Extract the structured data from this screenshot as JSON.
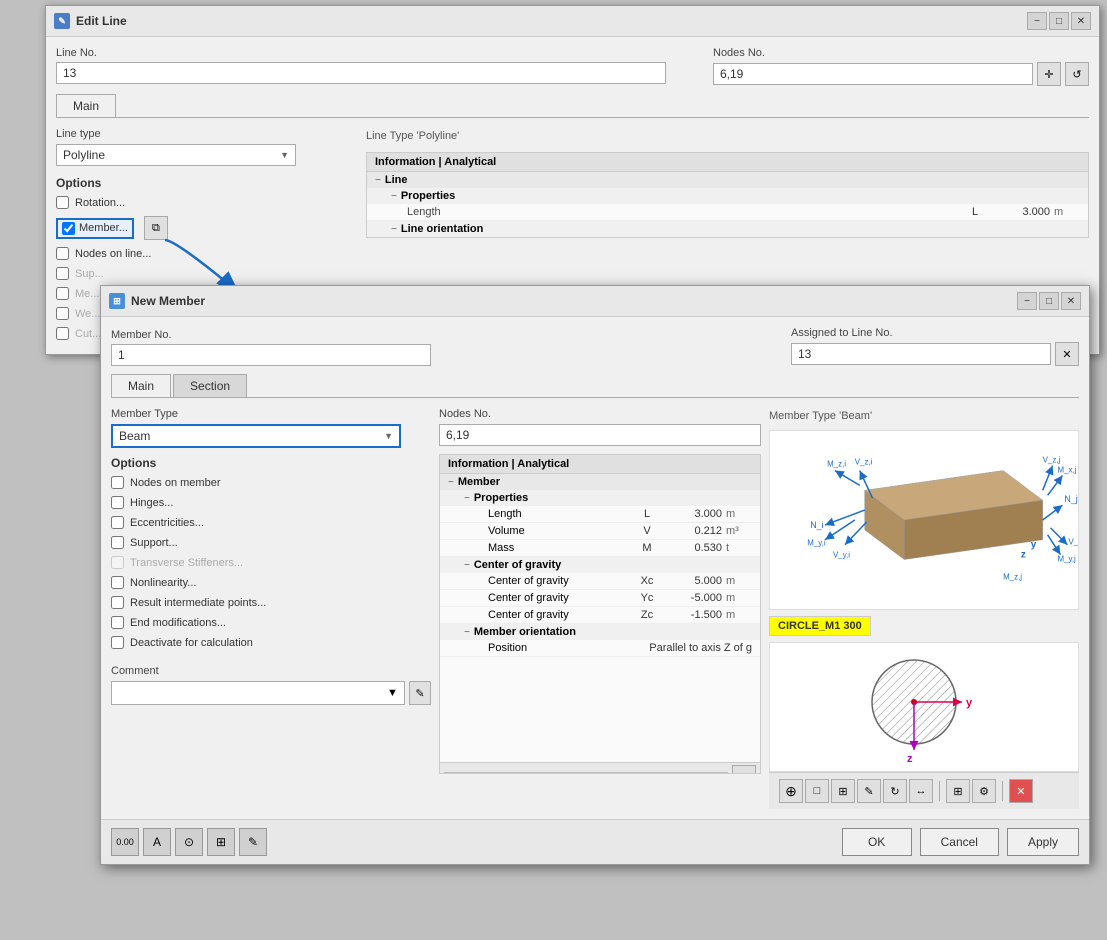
{
  "editLineDialog": {
    "title": "Edit Line",
    "lineNo": {
      "label": "Line No.",
      "value": "13"
    },
    "nodesNo": {
      "label": "Nodes No.",
      "value": "6,19"
    },
    "tabs": [
      {
        "label": "Main",
        "active": true
      }
    ],
    "lineType": {
      "label": "Line type",
      "value": "Polyline"
    },
    "lineTypeInfo": "Line Type 'Polyline'",
    "options": {
      "label": "Options",
      "items": [
        {
          "label": "Rotation...",
          "checked": false,
          "highlighted": false
        },
        {
          "label": "Member...",
          "checked": true,
          "highlighted": true
        },
        {
          "label": "Nodes on line...",
          "checked": false,
          "highlighted": false
        },
        {
          "label": "Supports...",
          "checked": false,
          "highlighted": false
        },
        {
          "label": "Meshing...",
          "checked": false,
          "highlighted": false
        },
        {
          "label": "Welded Joints...",
          "checked": false,
          "highlighted": false
        },
        {
          "label": "Cuts...",
          "checked": false,
          "highlighted": false
        }
      ]
    },
    "infoPanel": {
      "header": "Information | Analytical",
      "tree": {
        "line": {
          "label": "Line",
          "properties": {
            "label": "Properties",
            "length": {
              "label": "Length",
              "key": "L",
              "value": "3.000",
              "unit": "m"
            }
          },
          "lineOrientation": {
            "label": "Line orientation"
          }
        }
      }
    }
  },
  "newMemberDialog": {
    "title": "New Member",
    "memberNo": {
      "label": "Member No.",
      "value": "1"
    },
    "assignedToLineNo": {
      "label": "Assigned to Line No.",
      "value": "13"
    },
    "tabs": [
      {
        "label": "Main",
        "active": true
      },
      {
        "label": "Section",
        "active": false
      }
    ],
    "memberType": {
      "label": "Member Type",
      "value": "Beam"
    },
    "memberTypeLabel": "Member Type 'Beam'",
    "nodesNo": {
      "label": "Nodes No.",
      "value": "6,19"
    },
    "options": {
      "label": "Options",
      "items": [
        {
          "label": "Nodes on member",
          "checked": false,
          "disabled": false
        },
        {
          "label": "Hinges...",
          "checked": false,
          "disabled": false
        },
        {
          "label": "Eccentricities...",
          "checked": false,
          "disabled": false
        },
        {
          "label": "Support...",
          "checked": false,
          "disabled": false
        },
        {
          "label": "Transverse Stiffeners...",
          "checked": false,
          "disabled": true
        },
        {
          "label": "Nonlinearity...",
          "checked": false,
          "disabled": false
        },
        {
          "label": "Result intermediate points...",
          "checked": false,
          "disabled": false
        },
        {
          "label": "End modifications...",
          "checked": false,
          "disabled": false
        },
        {
          "label": "Deactivate for calculation",
          "checked": false,
          "disabled": false
        }
      ]
    },
    "infoPanel": {
      "header": "Information | Analytical",
      "member": {
        "label": "Member",
        "properties": {
          "label": "Properties",
          "items": [
            {
              "label": "Length",
              "key": "L",
              "value": "3.000",
              "unit": "m"
            },
            {
              "label": "Volume",
              "key": "V",
              "value": "0.212",
              "unit": "m³"
            },
            {
              "label": "Mass",
              "key": "M",
              "value": "0.530",
              "unit": "t"
            }
          ]
        },
        "centerOfGravity": {
          "label": "Center of gravity",
          "items": [
            {
              "label": "Center of gravity",
              "key": "Xc",
              "value": "5.000",
              "unit": "m"
            },
            {
              "label": "Center of gravity",
              "key": "Yc",
              "value": "-5.000",
              "unit": "m"
            },
            {
              "label": "Center of gravity",
              "key": "Zc",
              "value": "-1.500",
              "unit": "m"
            }
          ]
        },
        "memberOrientation": {
          "label": "Member orientation",
          "position": {
            "label": "Position",
            "value": "Parallel to axis Z of g"
          }
        }
      }
    },
    "crossSectionLabel": "CIRCLE_M1 300",
    "comment": {
      "label": "Comment",
      "value": ""
    },
    "buttons": {
      "ok": "OK",
      "cancel": "Cancel",
      "apply": "Apply"
    }
  },
  "icons": {
    "expand": "−",
    "collapse": "+",
    "close": "✕",
    "minimize": "−",
    "maximize": "□",
    "arrow": "→",
    "dropdown": "▼",
    "checkmark": "✓",
    "copy": "⧉",
    "reset": "↺",
    "crosshair": "⊕"
  }
}
